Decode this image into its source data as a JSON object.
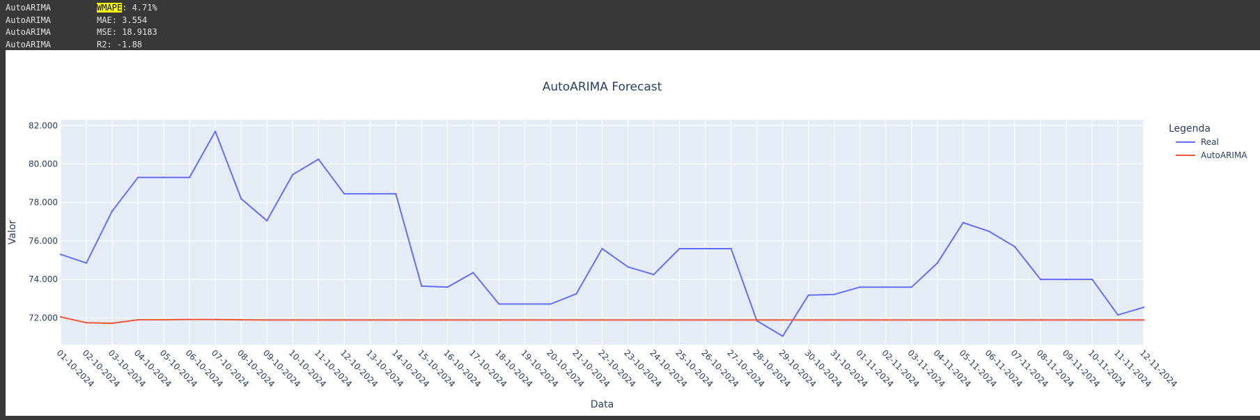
{
  "console": {
    "lines": [
      {
        "model": "AutoARIMA",
        "metric": "WMAPE",
        "value": ": 4.71%",
        "highlighted": true
      },
      {
        "model": "AutoARIMA",
        "metric": "MAE",
        "value": ": 3.554",
        "highlighted": false
      },
      {
        "model": "AutoARIMA",
        "metric": "MSE",
        "value": ": 18.9183",
        "highlighted": false
      },
      {
        "model": "AutoARIMA",
        "metric": "R2",
        "value": ": -1.88",
        "highlighted": false
      }
    ],
    "highlight_color": "#ffff00"
  },
  "chart_data": {
    "type": "line",
    "title": "AutoARIMA  Forecast",
    "xlabel": "Data",
    "ylabel": "Valor",
    "ylim": [
      70.6,
      82.3
    ],
    "yticks": [
      72,
      74,
      76,
      78,
      80,
      82
    ],
    "ytick_labels": [
      "72.000",
      "74.000",
      "76.000",
      "78.000",
      "80.000",
      "82.000"
    ],
    "grid": true,
    "legend": {
      "title": "Legenda",
      "position": "right"
    },
    "x": [
      "01-10-2024",
      "02-10-2024",
      "03-10-2024",
      "04-10-2024",
      "05-10-2024",
      "06-10-2024",
      "07-10-2024",
      "08-10-2024",
      "09-10-2024",
      "10-10-2024",
      "11-10-2024",
      "12-10-2024",
      "13-10-2024",
      "14-10-2024",
      "15-10-2024",
      "16-10-2024",
      "17-10-2024",
      "18-10-2024",
      "19-10-2024",
      "20-10-2024",
      "21-10-2024",
      "22-10-2024",
      "23-10-2024",
      "24-10-2024",
      "25-10-2024",
      "26-10-2024",
      "27-10-2024",
      "28-10-2024",
      "29-10-2024",
      "30-10-2024",
      "31-10-2024",
      "01-11-2024",
      "02-11-2024",
      "03-11-2024",
      "04-11-2024",
      "05-11-2024",
      "06-11-2024",
      "07-11-2024",
      "08-11-2024",
      "09-11-2024",
      "10-11-2024",
      "11-11-2024",
      "12-11-2024"
    ],
    "series": [
      {
        "name": "Real",
        "color": "#636efa",
        "values": [
          75.3,
          74.85,
          77.55,
          79.3,
          79.3,
          79.3,
          81.7,
          78.2,
          77.05,
          79.45,
          80.25,
          78.45,
          78.45,
          78.45,
          73.65,
          73.6,
          74.35,
          72.72,
          72.72,
          72.72,
          73.25,
          75.6,
          74.65,
          74.25,
          75.6,
          75.6,
          75.6,
          71.85,
          71.05,
          73.18,
          73.22,
          73.6,
          73.6,
          73.6,
          74.85,
          76.95,
          76.5,
          75.7,
          74.0,
          74.0,
          74.0,
          72.15,
          72.55
        ]
      },
      {
        "name": "AutoARIMA",
        "color": "#ef553b",
        "values": [
          72.05,
          71.75,
          71.72,
          71.9,
          71.9,
          71.92,
          71.91,
          71.9,
          71.89,
          71.89,
          71.89,
          71.89,
          71.89,
          71.89,
          71.89,
          71.89,
          71.89,
          71.89,
          71.89,
          71.89,
          71.89,
          71.89,
          71.89,
          71.89,
          71.89,
          71.89,
          71.89,
          71.89,
          71.89,
          71.89,
          71.89,
          71.89,
          71.89,
          71.89,
          71.89,
          71.89,
          71.89,
          71.89,
          71.89,
          71.89,
          71.89,
          71.89,
          71.89
        ]
      }
    ],
    "colors": {
      "plot_bg": "#e5ecf6",
      "grid": "#ffffff",
      "text": "#2a3f5f"
    }
  }
}
